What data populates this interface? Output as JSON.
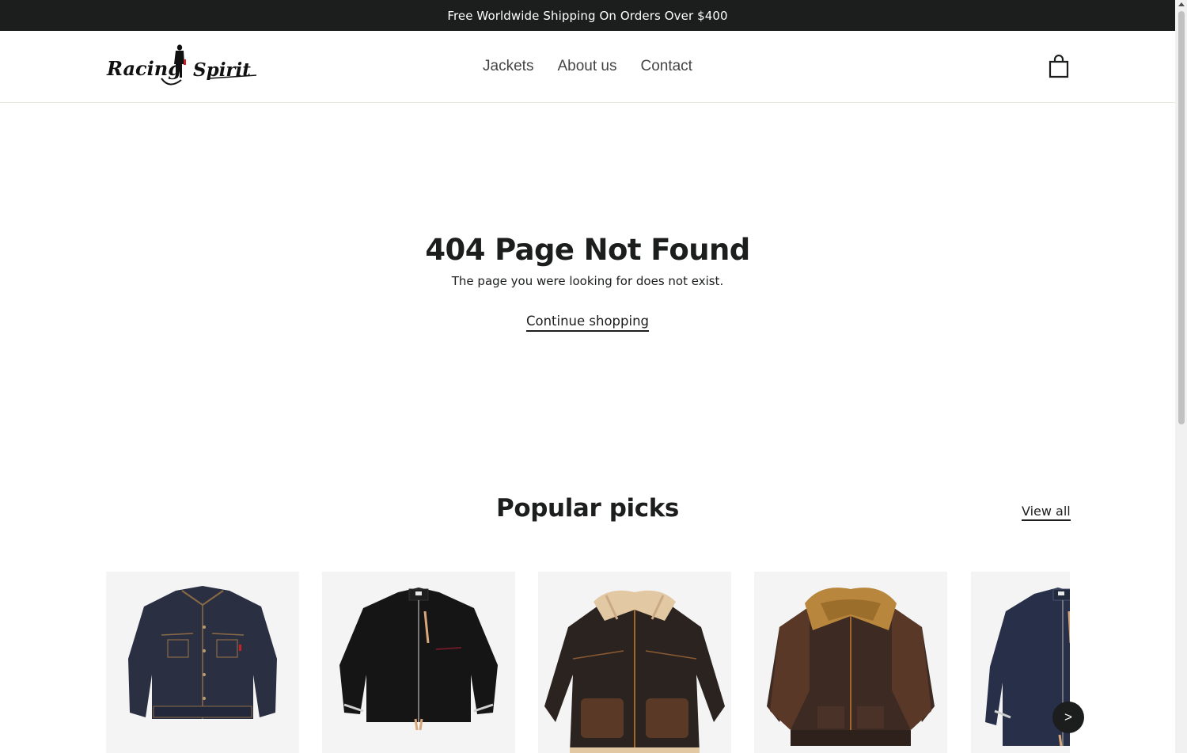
{
  "announcement": {
    "text": "Free Worldwide Shipping On Orders Over $400"
  },
  "header": {
    "logo_text": "Racing Spirit",
    "nav": [
      {
        "label": "Jackets"
      },
      {
        "label": "About us"
      },
      {
        "label": "Contact"
      }
    ],
    "cart_icon": "shopping-bag-icon"
  },
  "not_found": {
    "title": "404 Page Not Found",
    "message": "The page you were looking for does not exist.",
    "continue_label": "Continue shopping"
  },
  "popular": {
    "title": "Popular picks",
    "view_all_label": "View all",
    "products": [
      {
        "image": "indigo denim trucker jacket"
      },
      {
        "image": "black cafe racer jacket"
      },
      {
        "image": "brown leather shearling jacket"
      },
      {
        "image": "brown leather flight jacket with fur collar"
      },
      {
        "image": "indigo denim rider jacket"
      }
    ],
    "next_label": ">"
  },
  "colors": {
    "dark": "#1c1d1d",
    "card_bg": "#f4f4f4",
    "accent_red": "#c8202a"
  }
}
